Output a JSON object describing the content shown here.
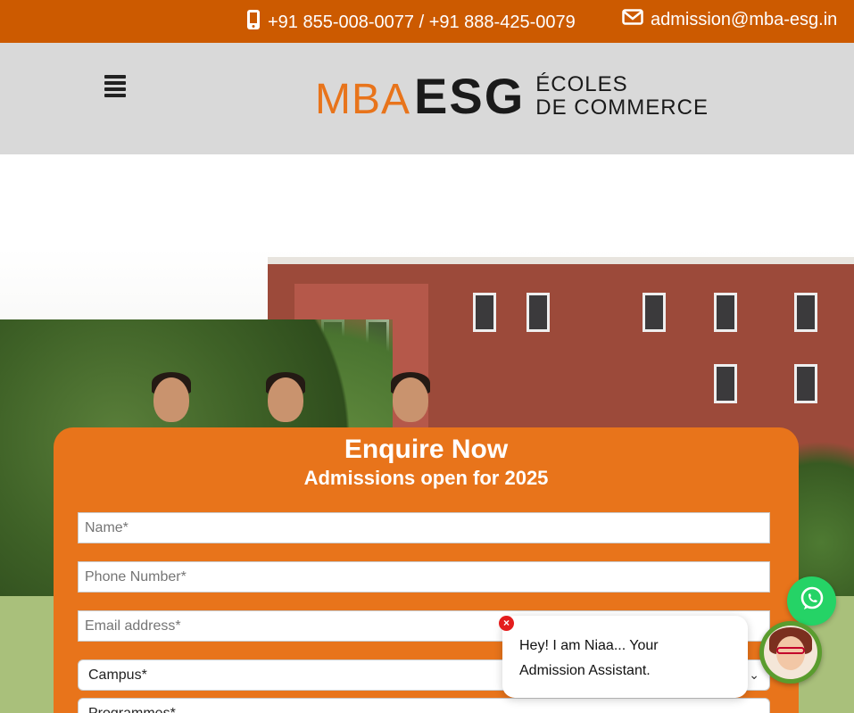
{
  "topbar": {
    "phone": "+91 855-008-0077 / +91 888-425-0079",
    "email": "admission@mba-esg.in"
  },
  "header": {
    "logo_mba": "MBA",
    "logo_esg": "ESG",
    "logo_tag_line1": "ÉCOLES",
    "logo_tag_line2": "DE COMMERCE"
  },
  "form": {
    "title": "Enquire Now",
    "subtitle": "Admissions open for 2025",
    "name_placeholder": "Name*",
    "phone_placeholder": "Phone Number*",
    "email_placeholder": "Email address*",
    "campus_label": "Campus*",
    "programmes_label": "Programmes*"
  },
  "chat": {
    "message_line1": "Hey! I am Niaa... Your",
    "message_line2": "Admission Assistant.",
    "close_label": "×"
  },
  "colors": {
    "brand_orange": "#e8741b",
    "topbar_orange": "#cc5a00",
    "whatsapp_green": "#25d366"
  }
}
